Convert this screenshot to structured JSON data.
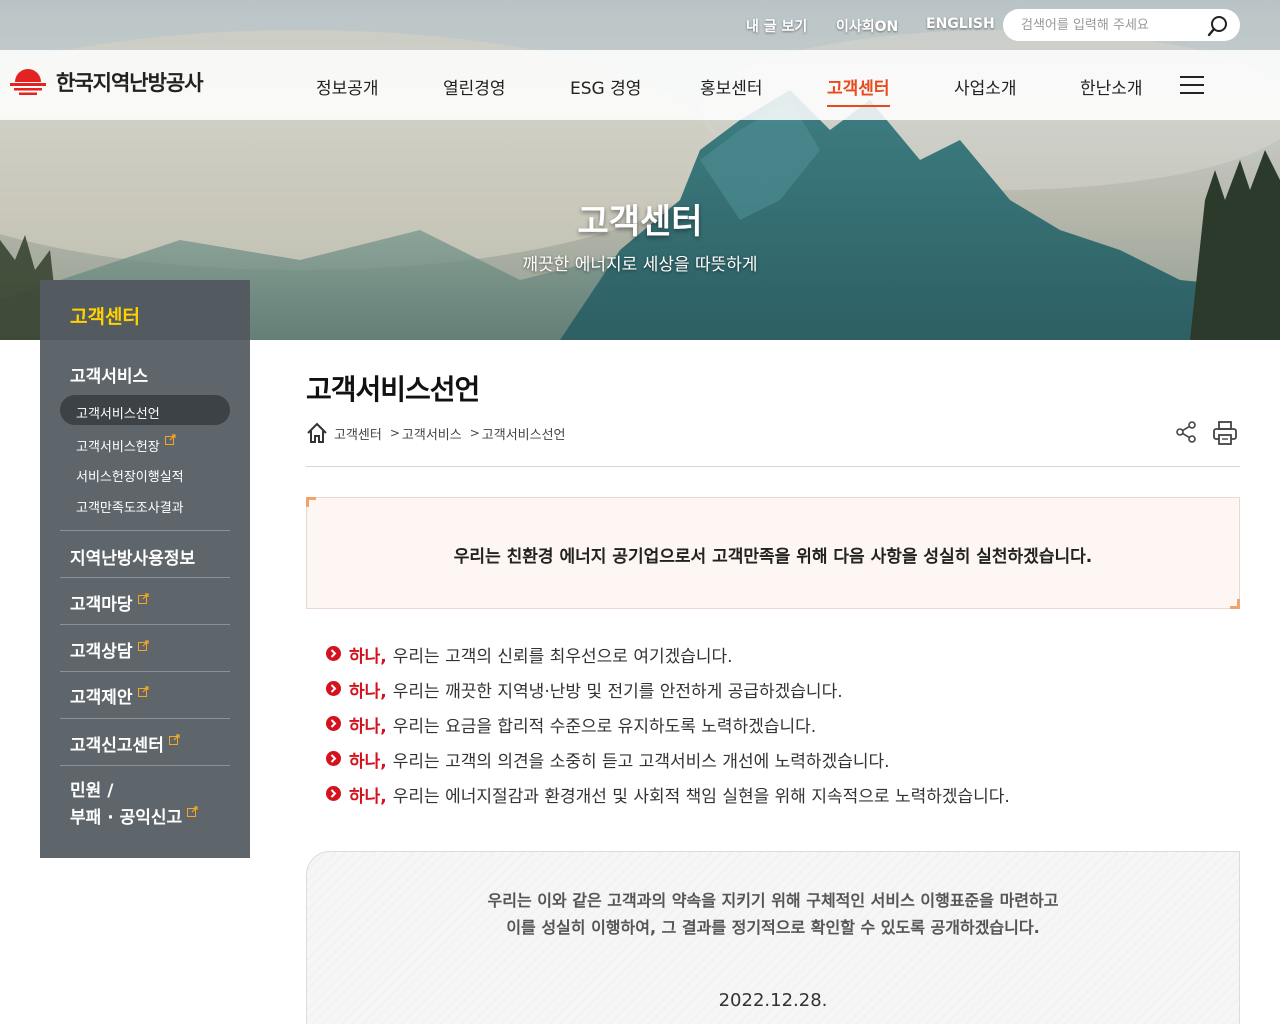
{
  "utility": {
    "my_posts": "내 글 보기",
    "board_on": "이사회ON",
    "english": "ENGLISH",
    "search_placeholder": "검색어를 입력해 주세요"
  },
  "header": {
    "logo_text": "한국지역난방공사",
    "nav": [
      {
        "label": "정보공개"
      },
      {
        "label": "열린경영"
      },
      {
        "label": "ESG 경영"
      },
      {
        "label": "홍보센터"
      },
      {
        "label": "고객센터"
      },
      {
        "label": "사업소개"
      },
      {
        "label": "한난소개"
      }
    ]
  },
  "hero": {
    "title": "고객센터",
    "subtitle": "깨끗한 에너지로 세상을 따뜻하게"
  },
  "sidebar": {
    "heading": "고객센터",
    "sections": [
      {
        "label": "고객서비스"
      },
      {
        "label": "지역난방사용정보"
      },
      {
        "label": "고객마당"
      },
      {
        "label": "고객상담"
      },
      {
        "label": "고객제안"
      },
      {
        "label": "고객신고센터"
      },
      {
        "label_line1": "민원 /",
        "label_line2": "부패 · 공익신고"
      }
    ],
    "sub_items": [
      {
        "label": "고객서비스선언"
      },
      {
        "label": "고객서비스헌장"
      },
      {
        "label": "서비스헌장이행실적"
      },
      {
        "label": "고객만족도조사결과"
      }
    ]
  },
  "main": {
    "title": "고객서비스선언",
    "breadcrumb": [
      "고객센터",
      "고객서비스",
      "고객서비스선언"
    ],
    "pledge_intro": "우리는 친환경 에너지 공기업으로서 고객만족을 위해 다음 사항을 성실히 실천하겠습니다.",
    "pledges": [
      {
        "prefix": "하나,",
        "text": "우리는 고객의 신뢰를 최우선으로 여기겠습니다."
      },
      {
        "prefix": "하나,",
        "text": "우리는 깨끗한 지역냉·난방 및 전기를 안전하게 공급하겠습니다."
      },
      {
        "prefix": "하나,",
        "text": "우리는 요금을 합리적 수준으로 유지하도록 노력하겠습니다."
      },
      {
        "prefix": "하나,",
        "text": "우리는 고객의 의견을 소중히 듣고 고객서비스 개선에 노력하겠습니다."
      },
      {
        "prefix": "하나,",
        "text": "우리는 에너지절감과 환경개선 및 사회적 책임 실현을 위해 지속적으로 노력하겠습니다."
      }
    ],
    "promise_line1": "우리는 이와 같은 고객과의 약속을 지키기 위해 구체적인 서비스 이행표준을 마련하고",
    "promise_line2": "이를 성실히 이행하여, 그 결과를 정기적으로 확인할 수 있도록 공개하겠습니다.",
    "date": "2022.12.28."
  },
  "colors": {
    "accent": "#e8491d",
    "brand_red": "#d4121f",
    "sidebar_bg": "#5f666b",
    "sidebar_heading": "#ffd200"
  }
}
